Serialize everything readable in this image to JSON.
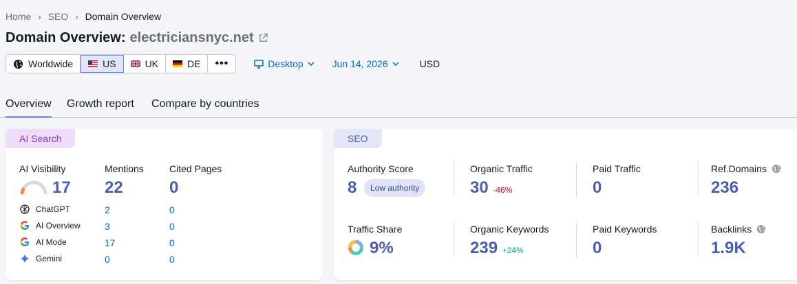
{
  "breadcrumb": {
    "items": [
      "Home",
      "SEO",
      "Domain Overview"
    ]
  },
  "title": {
    "prefix": "Domain Overview:",
    "domain": "electriciansnyc.net"
  },
  "databases": {
    "worldwide": "Worldwide",
    "us": "US",
    "uk": "UK",
    "de": "DE",
    "more": "•••",
    "selected": "US"
  },
  "filters": {
    "device": "Desktop",
    "date": "Jun 14, 2026",
    "currency": "USD"
  },
  "tabs": [
    "Overview",
    "Growth report",
    "Compare by countries"
  ],
  "ai_card": {
    "tag": "AI Search",
    "visibility_label": "AI Visibility",
    "visibility_value": "17",
    "mentions_label": "Mentions",
    "mentions_value": "22",
    "cited_label": "Cited Pages",
    "cited_value": "0",
    "rows": [
      {
        "name": "ChatGPT",
        "mentions": "2",
        "cited": "0"
      },
      {
        "name": "AI Overview",
        "mentions": "3",
        "cited": "0"
      },
      {
        "name": "AI Mode",
        "mentions": "17",
        "cited": "0"
      },
      {
        "name": "Gemini",
        "mentions": "0",
        "cited": "0"
      }
    ]
  },
  "seo_card": {
    "tag": "SEO",
    "authority_label": "Authority Score",
    "authority_value": "8",
    "authority_badge": "Low authority",
    "organic_traffic_label": "Organic Traffic",
    "organic_traffic_value": "30",
    "organic_traffic_delta": "-46%",
    "paid_traffic_label": "Paid Traffic",
    "paid_traffic_value": "0",
    "ref_domains_label": "Ref.Domains",
    "ref_domains_value": "236",
    "traffic_share_label": "Traffic Share",
    "traffic_share_value": "9%",
    "organic_keywords_label": "Organic Keywords",
    "organic_keywords_value": "239",
    "organic_keywords_delta": "+24%",
    "paid_keywords_label": "Paid Keywords",
    "paid_keywords_value": "0",
    "backlinks_label": "Backlinks",
    "backlinks_value": "1.9K"
  }
}
